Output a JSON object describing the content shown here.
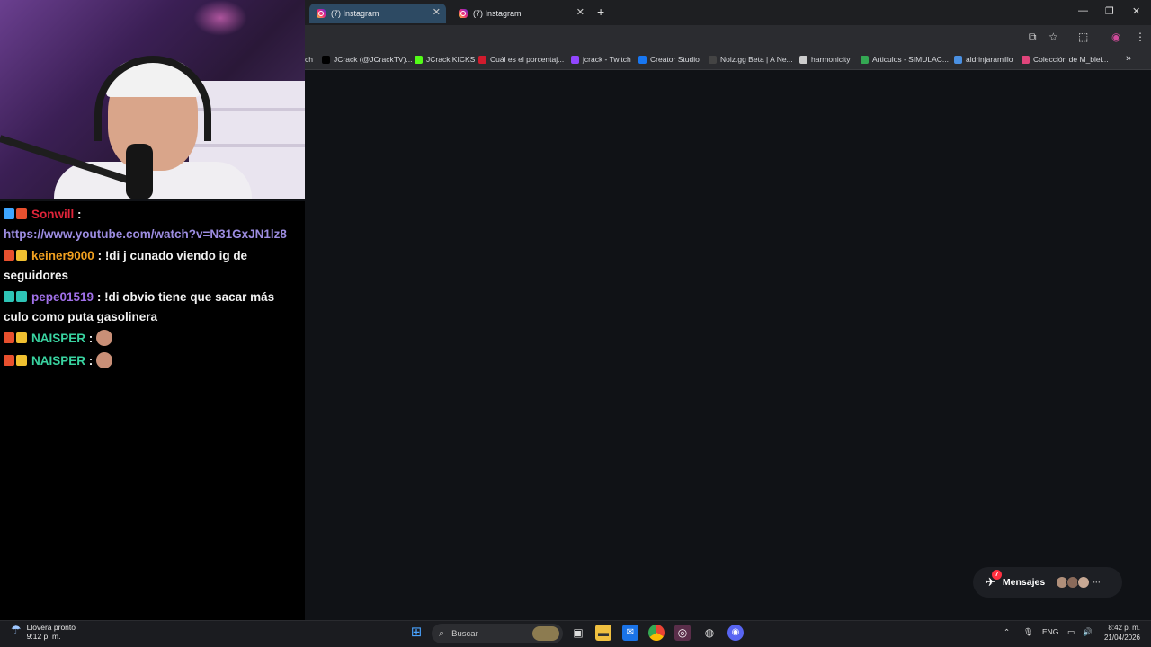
{
  "browser": {
    "tabs": [
      {
        "label": "(7) Instagram",
        "active": true
      },
      {
        "label": "(7) Instagram",
        "active": false
      }
    ],
    "bookmarks": [
      {
        "label": "ch",
        "color": "#000000"
      },
      {
        "label": "JCrack (@JCrackTV)...",
        "color": "#000000"
      },
      {
        "label": "JCrack KICKS",
        "color": "#53fc18"
      },
      {
        "label": "Cuál es el porcentaj...",
        "color": "#d11b2d"
      },
      {
        "label": "jcrack - Twitch",
        "color": "#9146ff"
      },
      {
        "label": "Creator Studio",
        "color": "#1877f2"
      },
      {
        "label": "Noiz.gg Beta | A Ne...",
        "color": "#444444"
      },
      {
        "label": "harmonicity",
        "color": "#cccccc"
      },
      {
        "label": "Articulos - SIMULAC...",
        "color": "#34a853"
      },
      {
        "label": "aldrinjaramillo",
        "color": "#4a90e2"
      },
      {
        "label": "Colección de M_blei...",
        "color": "#e0457b"
      }
    ],
    "more_bookmarks": "»"
  },
  "chat": {
    "messages": [
      {
        "user": "Sonwill",
        "user_color": "#e0243a",
        "sep": " :",
        "text": "",
        "link": "https://www.youtube.com/watch?v=N31GxJN1lz8",
        "emote": false
      },
      {
        "user": "keiner9000",
        "user_color": "#f0a020",
        "sep": " :",
        "text": " !di j cunado viendo ig de seguidores",
        "link": "",
        "emote": false
      },
      {
        "user": "pepe01519",
        "user_color": "#a070e8",
        "sep": " :",
        "text": " !di obvio tiene que sacar más culo como puta gasolinera",
        "link": "",
        "emote": false
      },
      {
        "user": "NAISPER",
        "user_color": "#39d3a0",
        "sep": " :",
        "text": "",
        "link": "",
        "emote": true
      },
      {
        "user": "NAISPER",
        "user_color": "#39d3a0",
        "sep": " :",
        "text": "",
        "link": "",
        "emote": true
      }
    ]
  },
  "instagram": {
    "messages_label": "Mensajes",
    "messages_count": "7"
  },
  "taskbar": {
    "weather_line1": "Lloverá pronto",
    "weather_line2": "9:12 p. m.",
    "search_label": "Buscar",
    "lang": "ENG",
    "time": "8:42 p. m.",
    "date": "21/04/2026"
  }
}
